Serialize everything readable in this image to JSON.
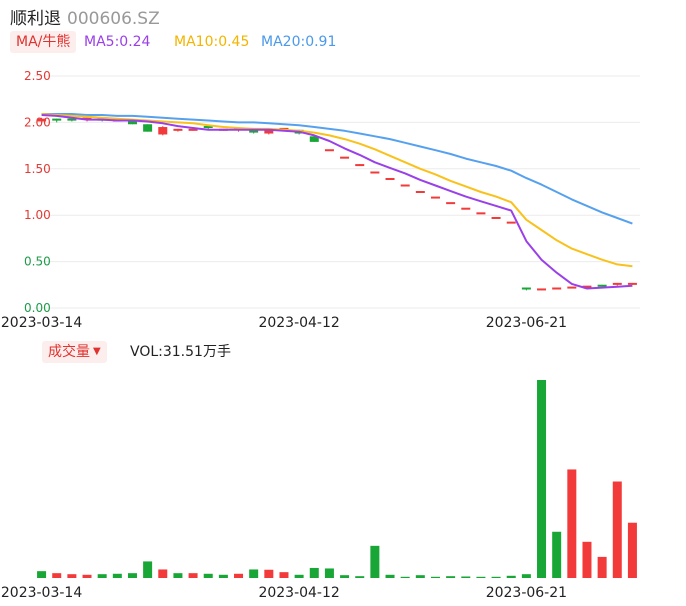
{
  "header": {
    "name": "顺利退",
    "code": "000606.SZ"
  },
  "ma_legend": {
    "tag": "MA/牛熊",
    "ma5": "MA5:0.24",
    "ma10": "MA10:0.45",
    "ma20": "MA20:0.91"
  },
  "vol_legend": {
    "tag": "成交量",
    "value": "VOL:31.51万手"
  },
  "colors": {
    "up": "#f23a3a",
    "down": "#18a636",
    "ma5": "#9a40e8",
    "ma10": "#f9c11a",
    "ma20": "#56a1ef",
    "grid": "#ebebeb",
    "axis_up": "#e23a36",
    "axis_down": "#1f9a4a"
  },
  "chart_data": [
    {
      "type": "candlestick",
      "ylim": [
        0,
        2.5
      ],
      "yticks": [
        "2.50",
        "2.00",
        "1.50",
        "1.00",
        "0.50",
        "0.00"
      ],
      "xtick_labels": [
        "2023-03-14",
        "2023-04-12",
        "2023-06-21"
      ],
      "xtick_index": [
        0,
        17,
        32
      ],
      "grid": true,
      "candles": [
        {
          "o": 2.01,
          "c": 2.04,
          "h": 2.05,
          "l": 2.0
        },
        {
          "o": 2.03,
          "c": 2.02,
          "h": 2.04,
          "l": 2.0
        },
        {
          "o": 2.03,
          "c": 2.02,
          "h": 2.03,
          "l": 2.01
        },
        {
          "o": 2.02,
          "c": 2.04,
          "h": 2.05,
          "l": 2.01
        },
        {
          "o": 2.03,
          "c": 2.02,
          "h": 2.03,
          "l": 2.01
        },
        {
          "o": 2.02,
          "c": 2.02,
          "h": 2.03,
          "l": 2.01
        },
        {
          "o": 2.01,
          "c": 1.98,
          "h": 2.02,
          "l": 1.98
        },
        {
          "o": 1.98,
          "c": 1.9,
          "h": 1.98,
          "l": 1.9
        },
        {
          "o": 1.87,
          "c": 1.95,
          "h": 1.96,
          "l": 1.86
        },
        {
          "o": 1.92,
          "c": 1.92,
          "h": 1.93,
          "l": 1.9
        },
        {
          "o": 1.92,
          "c": 1.92,
          "h": 1.93,
          "l": 1.91
        },
        {
          "o": 1.95,
          "c": 1.93,
          "h": 1.95,
          "l": 1.92
        },
        {
          "o": 1.92,
          "c": 1.92,
          "h": 1.93,
          "l": 1.91
        },
        {
          "o": 1.91,
          "c": 1.93,
          "h": 1.93,
          "l": 1.9
        },
        {
          "o": 1.92,
          "c": 1.89,
          "h": 1.93,
          "l": 1.88
        },
        {
          "o": 1.88,
          "c": 1.92,
          "h": 1.93,
          "l": 1.87
        },
        {
          "o": 1.93,
          "c": 1.93,
          "h": 1.94,
          "l": 1.92
        },
        {
          "o": 1.92,
          "c": 1.88,
          "h": 1.92,
          "l": 1.87
        },
        {
          "o": 1.85,
          "c": 1.79,
          "h": 1.85,
          "l": 1.79
        },
        {
          "o": 1.7,
          "c": 1.7,
          "h": 1.7,
          "l": 1.7
        },
        {
          "o": 1.62,
          "c": 1.62,
          "h": 1.62,
          "l": 1.62
        },
        {
          "o": 1.54,
          "c": 1.54,
          "h": 1.55,
          "l": 1.53
        },
        {
          "o": 1.46,
          "c": 1.46,
          "h": 1.46,
          "l": 1.46
        },
        {
          "o": 1.39,
          "c": 1.39,
          "h": 1.39,
          "l": 1.39
        },
        {
          "o": 1.32,
          "c": 1.32,
          "h": 1.32,
          "l": 1.32
        },
        {
          "o": 1.25,
          "c": 1.25,
          "h": 1.25,
          "l": 1.25
        },
        {
          "o": 1.19,
          "c": 1.19,
          "h": 1.19,
          "l": 1.19
        },
        {
          "o": 1.13,
          "c": 1.13,
          "h": 1.13,
          "l": 1.13
        },
        {
          "o": 1.07,
          "c": 1.07,
          "h": 1.07,
          "l": 1.07
        },
        {
          "o": 1.02,
          "c": 1.02,
          "h": 1.02,
          "l": 1.02
        },
        {
          "o": 0.97,
          "c": 0.97,
          "h": 0.97,
          "l": 0.97
        },
        {
          "o": 0.92,
          "c": 0.92,
          "h": 0.92,
          "l": 0.92
        },
        {
          "o": 0.21,
          "c": 0.2,
          "h": 0.22,
          "l": 0.19
        },
        {
          "o": 0.2,
          "c": 0.2,
          "h": 0.2,
          "l": 0.19
        },
        {
          "o": 0.2,
          "c": 0.21,
          "h": 0.21,
          "l": 0.2
        },
        {
          "o": 0.21,
          "c": 0.22,
          "h": 0.22,
          "l": 0.21
        },
        {
          "o": 0.22,
          "c": 0.23,
          "h": 0.23,
          "l": 0.22
        },
        {
          "o": 0.24,
          "c": 0.23,
          "h": 0.25,
          "l": 0.23
        },
        {
          "o": 0.24,
          "c": 0.26,
          "h": 0.27,
          "l": 0.24
        },
        {
          "o": 0.25,
          "c": 0.26,
          "h": 0.27,
          "l": 0.25
        }
      ],
      "ma5": [
        2.08,
        2.07,
        2.05,
        2.03,
        2.03,
        2.02,
        2.02,
        2.01,
        1.99,
        1.96,
        1.94,
        1.92,
        1.92,
        1.92,
        1.92,
        1.92,
        1.91,
        1.9,
        1.86,
        1.8,
        1.72,
        1.65,
        1.57,
        1.51,
        1.45,
        1.38,
        1.32,
        1.26,
        1.2,
        1.15,
        1.1,
        1.05,
        0.72,
        0.52,
        0.38,
        0.26,
        0.21,
        0.22,
        0.23,
        0.24
      ],
      "ma10": [
        2.09,
        2.08,
        2.07,
        2.06,
        2.05,
        2.04,
        2.03,
        2.02,
        2.01,
        2.0,
        1.99,
        1.97,
        1.95,
        1.94,
        1.93,
        1.93,
        1.92,
        1.91,
        1.89,
        1.86,
        1.82,
        1.77,
        1.71,
        1.64,
        1.57,
        1.5,
        1.44,
        1.37,
        1.31,
        1.25,
        1.2,
        1.14,
        0.95,
        0.84,
        0.73,
        0.64,
        0.58,
        0.52,
        0.47,
        0.45
      ],
      "ma20": [
        2.09,
        2.09,
        2.09,
        2.08,
        2.08,
        2.07,
        2.07,
        2.06,
        2.05,
        2.04,
        2.03,
        2.02,
        2.01,
        2.0,
        2.0,
        1.99,
        1.98,
        1.97,
        1.95,
        1.93,
        1.91,
        1.88,
        1.85,
        1.82,
        1.78,
        1.74,
        1.7,
        1.66,
        1.61,
        1.57,
        1.53,
        1.48,
        1.4,
        1.33,
        1.25,
        1.17,
        1.1,
        1.03,
        0.97,
        0.91
      ]
    },
    {
      "type": "bar",
      "title": "成交量",
      "values": [
        6.8,
        4.8,
        3.8,
        3.2,
        3.8,
        4.2,
        4.8,
        16.5,
        8.5,
        4.8,
        4.8,
        4.2,
        3.2,
        4.2,
        8.5,
        8.2,
        5.8,
        3.2,
        10.0,
        9.5,
        2.8,
        1.8,
        32.0,
        3.2,
        1.2,
        2.8,
        1.2,
        1.8,
        1.5,
        1.2,
        1.2,
        2.2,
        3.8,
        197.0,
        46.0,
        108.0,
        36.0,
        21.0,
        96.0,
        55.0
      ],
      "directions": [
        "down",
        "up",
        "up",
        "up",
        "down",
        "down",
        "down",
        "down",
        "up",
        "down",
        "up",
        "down",
        "down",
        "up",
        "down",
        "up",
        "up",
        "down",
        "down",
        "down",
        "down",
        "down",
        "down",
        "down",
        "down",
        "down",
        "down",
        "down",
        "down",
        "down",
        "down",
        "down",
        "down",
        "down",
        "down",
        "up",
        "up",
        "up",
        "up",
        "up"
      ]
    }
  ]
}
